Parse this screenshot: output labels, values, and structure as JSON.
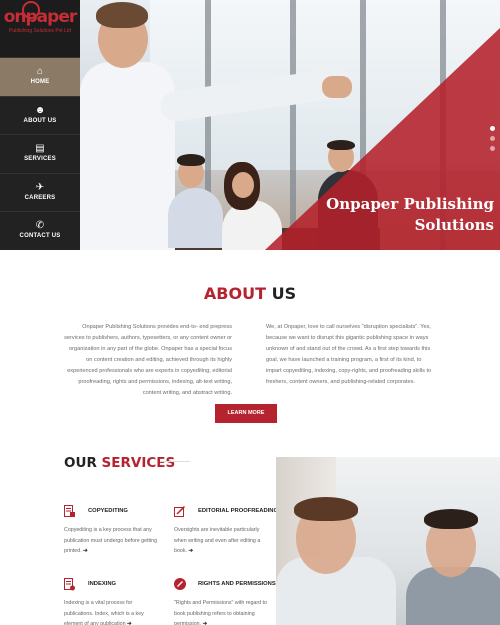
{
  "brand": {
    "logo_text": "onpaper",
    "logo_subtitle": "Publishing Solutions Pvt Ltd",
    "accent": "#b5232e",
    "sidebar_bg": "#222222",
    "active_bg": "#8a7a66"
  },
  "nav": {
    "items": [
      {
        "label": "HOME",
        "icon": "home-icon",
        "glyph": "⌂",
        "active": true
      },
      {
        "label": "ABOUT US",
        "icon": "users-icon",
        "glyph": "☻",
        "active": false
      },
      {
        "label": "SERVICES",
        "icon": "document-icon",
        "glyph": "▤",
        "active": false
      },
      {
        "label": "CAREERS",
        "icon": "running-icon",
        "glyph": "✈",
        "active": false
      },
      {
        "label": "CONTACT US",
        "icon": "phone-icon",
        "glyph": "✆",
        "active": false
      }
    ]
  },
  "hero": {
    "title_line1": "Onpaper Publishing",
    "title_line2": "Solutions",
    "slides_count": 3,
    "active_slide": 1
  },
  "about": {
    "title_accent": "ABOUT",
    "title_rest": " US",
    "left_text": "Onpaper Publishing Solutions provides end-to- end prepress services to publishers, authors, typesetters, or any content owner or organization in any part of the globe. Onpaper has a special focus on content creation and editing, achieved through its highly experienced professionals who are experts in copyediting, editorial proofreading, rights and permissions, indexing, alt-text writing, content writing, and abstract writing.",
    "right_text": "We, at Onpaper, love to call ourselves \"disruption specialists\". Yes, because we want to disrupt this gigantic publishing space in ways unknown of and stand out of the crowd. As a first step towards this goal, we have launched a training program, a first of its kind, to impart copyediting, indexing, copy-rights, and proofreading skills to freshers, content owners, and publishing-related corporates.",
    "button_label": "LEARN MORE"
  },
  "services": {
    "title_dark": "OUR",
    "title_accent": " SERVICES",
    "items": [
      {
        "title": "COPYEDITING",
        "icon": "document-pen-icon",
        "desc": "Copyediting is a key process that any publication must undergo before getting printed.",
        "arrow": "➔"
      },
      {
        "title": "EDITORIAL PROOFREADING",
        "icon": "edit-icon",
        "desc": "Oversights are inevitable particularly when writing and even after editing a book.",
        "arrow": "➔"
      },
      {
        "title": "INDEXING",
        "icon": "index-document-icon",
        "desc": "Indexing is a vital process for publications. Index, which is a key element of any publication",
        "arrow": "➔"
      },
      {
        "title": "RIGHTS AND PERMISSIONS",
        "icon": "pen-circle-icon",
        "desc": "\"Rights and Permissions\" with regard to book publishing refers to obtaining permission.",
        "arrow": "➔"
      }
    ]
  }
}
